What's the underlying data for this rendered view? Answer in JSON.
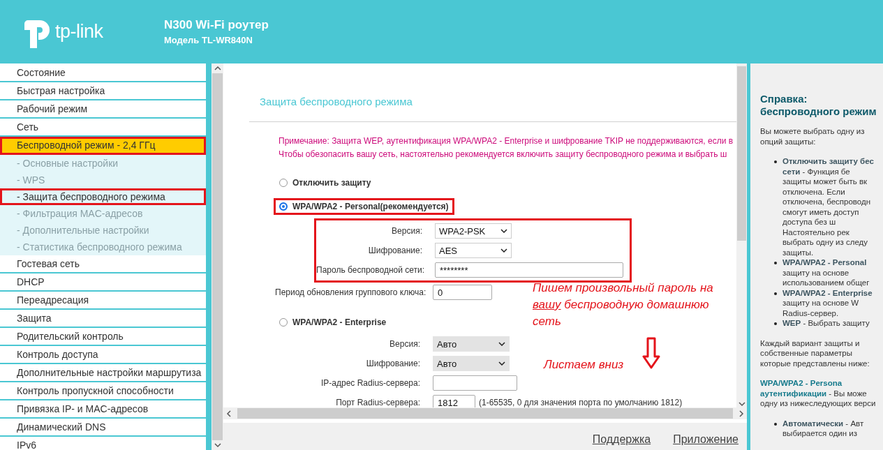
{
  "header": {
    "title": "N300 Wi-Fi роутер",
    "model": "Модель TL-WR840N",
    "logo_text": "tp-link"
  },
  "sidebar": {
    "items": [
      {
        "label": "Состояние",
        "kind": "main",
        "selected": false,
        "framed": false
      },
      {
        "label": "Быстрая настройка",
        "kind": "main",
        "selected": false,
        "framed": false
      },
      {
        "label": "Рабочий режим",
        "kind": "main",
        "selected": false,
        "framed": false
      },
      {
        "label": "Сеть",
        "kind": "main",
        "selected": false,
        "framed": false
      },
      {
        "label": "Беспроводной режим - 2,4 ГГц",
        "kind": "main",
        "selected": true,
        "framed": true
      },
      {
        "label": "- Основные настройки",
        "kind": "sub",
        "selected": false,
        "framed": false
      },
      {
        "label": "- WPS",
        "kind": "sub",
        "selected": false,
        "framed": false
      },
      {
        "label": "- Защита беспроводного режима",
        "kind": "sub",
        "selected": true,
        "framed": true
      },
      {
        "label": "- Фильтрация MAC-адресов",
        "kind": "sub",
        "selected": false,
        "framed": false
      },
      {
        "label": "- Дополнительные настройки",
        "kind": "sub",
        "selected": false,
        "framed": false
      },
      {
        "label": "- Статистика беспроводного режима",
        "kind": "sub",
        "selected": false,
        "framed": false
      },
      {
        "label": "Гостевая сеть",
        "kind": "main",
        "selected": false,
        "framed": false
      },
      {
        "label": "DHCP",
        "kind": "main",
        "selected": false,
        "framed": false
      },
      {
        "label": "Переадресация",
        "kind": "main",
        "selected": false,
        "framed": false
      },
      {
        "label": "Защита",
        "kind": "main",
        "selected": false,
        "framed": false
      },
      {
        "label": "Родительский контроль",
        "kind": "main",
        "selected": false,
        "framed": false
      },
      {
        "label": "Контроль доступа",
        "kind": "main",
        "selected": false,
        "framed": false
      },
      {
        "label": "Дополнительные настройки маршрутиза",
        "kind": "main",
        "selected": false,
        "framed": false
      },
      {
        "label": "Контроль пропускной способности",
        "kind": "main",
        "selected": false,
        "framed": false
      },
      {
        "label": "Привязка IP- и MAC-адресов",
        "kind": "main",
        "selected": false,
        "framed": false
      },
      {
        "label": "Динамический DNS",
        "kind": "main",
        "selected": false,
        "framed": false
      },
      {
        "label": "IPv6",
        "kind": "main",
        "selected": false,
        "framed": false
      }
    ]
  },
  "content": {
    "title": "Защита беспроводного режима",
    "notes": [
      "Примечание: Защита WEP, аутентификация WPA/WPA2 - Enterprise и шифрование TKIP не поддерживаются, если в",
      "Чтобы обезопасить вашу сеть, настоятельно рекомендуется включить защиту беспроводного режима и выбрать ш"
    ],
    "options": [
      {
        "label": "Отключить защиту",
        "selected": false,
        "framed": false
      },
      {
        "label": "WPA/WPA2 - Personal(рекомендуется)",
        "selected": true,
        "framed": true,
        "fields": [
          {
            "label": "Версия:",
            "kind": "select",
            "value": "WPA2-PSK",
            "disabled": false,
            "framed": true
          },
          {
            "label": "Шифрование:",
            "kind": "select",
            "value": "AES",
            "disabled": false,
            "framed": true
          },
          {
            "label": "Пароль беспроводной сети:",
            "kind": "wide",
            "value": "********",
            "framed": true
          },
          {
            "label": "Период обновления группового ключа:",
            "kind": "short",
            "value": "0",
            "framed": false
          }
        ]
      },
      {
        "label": "WPA/WPA2 - Enterprise",
        "selected": false,
        "framed": false,
        "fields": [
          {
            "label": "Версия:",
            "kind": "select",
            "value": "Авто",
            "disabled": true,
            "framed": false
          },
          {
            "label": "Шифрование:",
            "kind": "select",
            "value": "Авто",
            "disabled": true,
            "framed": false
          },
          {
            "label": "IP-адрес Radius-сервера:",
            "kind": "medium",
            "framed": false
          },
          {
            "label": "Порт Radius-сервера:",
            "kind": "port",
            "value": "1812",
            "hint": "(1-65535, 0 для значения порта по умолчанию 1812)",
            "framed": false
          }
        ]
      }
    ],
    "annotations": [
      {
        "kind": "note",
        "lines": [
          [
            {
              "text": "Пишем произвольный пароль на",
              "underline": false
            }
          ],
          [
            {
              "text": "вашу",
              "underline": true
            },
            {
              "text": " беспроводную домашнюю",
              "underline": false
            }
          ],
          [
            {
              "text": "сеть",
              "underline": false
            }
          ]
        ]
      },
      {
        "kind": "scroll",
        "lines": [
          [
            {
              "text": "Листаем вниз",
              "underline": false
            }
          ]
        ]
      }
    ]
  },
  "footer": {
    "links": [
      "Поддержка",
      "Приложение"
    ]
  },
  "help": {
    "title": [
      "Справка:",
      "беспроводного режим"
    ],
    "blocks": [
      {
        "kind": "para",
        "lines": [
          "Вы можете выбрать одну из",
          "опций защиты:"
        ]
      },
      {
        "kind": "bullets",
        "items": [
          [
            "**Отключить защиту бес**",
            "**сети** - Функция бе",
            "защиты может быть вк",
            "отключена. Если",
            "отключена, беспроводн",
            "смогут иметь доступ",
            "доступа без ш",
            "Настоятельно рек",
            "выбрать одну из следу",
            "защиты."
          ],
          [
            "**WPA/WPA2 - Personal**",
            "защиту на основе",
            "использованием общег"
          ],
          [
            "**WPA/WPA2 - Enterprise**",
            "защиту на основе W",
            "Radius-сервер."
          ],
          [
            "**WEP** - Выбрать защиту"
          ]
        ]
      },
      {
        "kind": "para",
        "lines": [
          "Каждый вариант защиты и",
          "собственные параметры",
          "которые представлены ниже:"
        ]
      },
      {
        "kind": "section",
        "lines": [
          "**WPA/WPA2 - Persona**",
          "**аутентификации** - Вы може",
          "одну из нижеследующих верси"
        ]
      },
      {
        "kind": "bullets",
        "items": [
          [
            "**Автоматически** - Авт",
            "выбирается один из"
          ]
        ]
      }
    ]
  }
}
